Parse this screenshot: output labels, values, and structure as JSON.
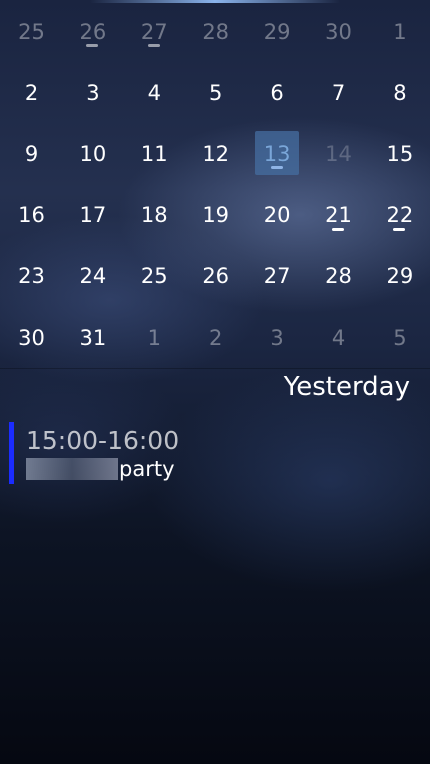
{
  "calendar": {
    "rows": [
      [
        {
          "day": "25",
          "state": "dim"
        },
        {
          "day": "26",
          "state": "dim",
          "event": "gray"
        },
        {
          "day": "27",
          "state": "dim",
          "event": "gray"
        },
        {
          "day": "28",
          "state": "dim"
        },
        {
          "day": "29",
          "state": "dim"
        },
        {
          "day": "30",
          "state": "dim"
        },
        {
          "day": "1",
          "state": "dim"
        }
      ],
      [
        {
          "day": "2",
          "state": "normal"
        },
        {
          "day": "3",
          "state": "normal"
        },
        {
          "day": "4",
          "state": "normal"
        },
        {
          "day": "5",
          "state": "normal"
        },
        {
          "day": "6",
          "state": "normal"
        },
        {
          "day": "7",
          "state": "normal"
        },
        {
          "day": "8",
          "state": "normal"
        }
      ],
      [
        {
          "day": "9",
          "state": "normal"
        },
        {
          "day": "10",
          "state": "normal"
        },
        {
          "day": "11",
          "state": "normal"
        },
        {
          "day": "12",
          "state": "normal"
        },
        {
          "day": "13",
          "state": "today",
          "event": "blue"
        },
        {
          "day": "14",
          "state": "disabled"
        },
        {
          "day": "15",
          "state": "normal"
        }
      ],
      [
        {
          "day": "16",
          "state": "normal"
        },
        {
          "day": "17",
          "state": "normal"
        },
        {
          "day": "18",
          "state": "normal"
        },
        {
          "day": "19",
          "state": "normal"
        },
        {
          "day": "20",
          "state": "normal"
        },
        {
          "day": "21",
          "state": "normal",
          "event": "white"
        },
        {
          "day": "22",
          "state": "normal",
          "event": "white"
        }
      ],
      [
        {
          "day": "23",
          "state": "normal"
        },
        {
          "day": "24",
          "state": "normal"
        },
        {
          "day": "25",
          "state": "normal"
        },
        {
          "day": "26",
          "state": "normal"
        },
        {
          "day": "27",
          "state": "normal"
        },
        {
          "day": "28",
          "state": "normal"
        },
        {
          "day": "29",
          "state": "normal"
        }
      ],
      [
        {
          "day": "30",
          "state": "normal"
        },
        {
          "day": "31",
          "state": "normal"
        },
        {
          "day": "1",
          "state": "dim"
        },
        {
          "day": "2",
          "state": "dim"
        },
        {
          "day": "3",
          "state": "dim"
        },
        {
          "day": "4",
          "state": "dim"
        },
        {
          "day": "5",
          "state": "dim"
        }
      ]
    ]
  },
  "agenda": {
    "section_title": "Yesterday",
    "events": [
      {
        "time": "15:00-16:00",
        "title_visible": "party",
        "color": "#1b2cff"
      }
    ]
  },
  "colors": {
    "today_highlight": "#466ea0",
    "event_bar": "#1b2cff"
  }
}
